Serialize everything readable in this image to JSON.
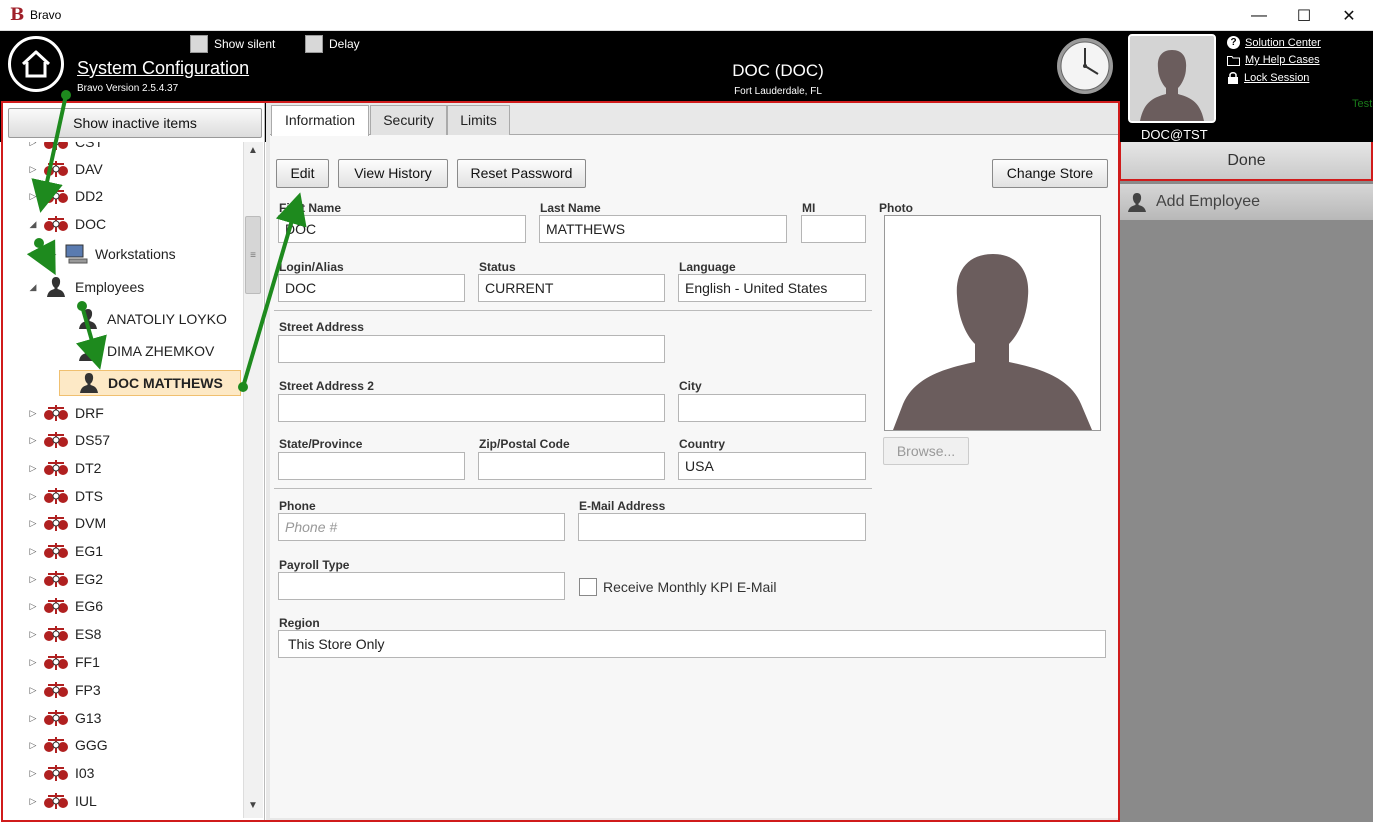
{
  "window": {
    "title": "Bravo",
    "logo": "B",
    "controls": {
      "minimize": "—",
      "maximize": "☐",
      "close": "✕"
    }
  },
  "header": {
    "title": "System Configuration",
    "version": "Bravo Version 2.5.4.37",
    "show_silent": "Show silent",
    "delay": "Delay",
    "store_title": "DOC (DOC)",
    "store_location": "Fort Lauderdale, FL",
    "user": "DOC@TST",
    "links": {
      "solution_center": "Solution Center",
      "help_cases": "My Help Cases",
      "lock_session": "Lock Session"
    },
    "env_label": "Test"
  },
  "sidebar": {
    "show_inactive": "Show inactive items",
    "tree": [
      {
        "label": "CST",
        "arrow": "▷",
        "kind": "store"
      },
      {
        "label": "DAV",
        "arrow": "▷",
        "kind": "store"
      },
      {
        "label": "DD2",
        "arrow": "▷",
        "kind": "store"
      },
      {
        "label": "DOC",
        "arrow": "◢",
        "kind": "store"
      },
      {
        "label": "Workstations",
        "arrow": "▷",
        "kind": "computer"
      },
      {
        "label": "Employees",
        "arrow": "◢",
        "kind": "person"
      },
      {
        "label": "ANATOLIY LOYKO",
        "arrow": "",
        "kind": "person"
      },
      {
        "label": "DIMA ZHEMKOV",
        "arrow": "",
        "kind": "person"
      },
      {
        "label": "DOC MATTHEWS",
        "arrow": "",
        "kind": "person"
      },
      {
        "label": "DRF",
        "arrow": "▷",
        "kind": "store"
      },
      {
        "label": "DS57",
        "arrow": "▷",
        "kind": "store"
      },
      {
        "label": "DT2",
        "arrow": "▷",
        "kind": "store"
      },
      {
        "label": "DTS",
        "arrow": "▷",
        "kind": "store"
      },
      {
        "label": "DVM",
        "arrow": "▷",
        "kind": "store"
      },
      {
        "label": "EG1",
        "arrow": "▷",
        "kind": "store"
      },
      {
        "label": "EG2",
        "arrow": "▷",
        "kind": "store"
      },
      {
        "label": "EG6",
        "arrow": "▷",
        "kind": "store"
      },
      {
        "label": "ES8",
        "arrow": "▷",
        "kind": "store"
      },
      {
        "label": "FF1",
        "arrow": "▷",
        "kind": "store"
      },
      {
        "label": "FP3",
        "arrow": "▷",
        "kind": "store"
      },
      {
        "label": "G13",
        "arrow": "▷",
        "kind": "store"
      },
      {
        "label": "GGG",
        "arrow": "▷",
        "kind": "store"
      },
      {
        "label": "I03",
        "arrow": "▷",
        "kind": "store"
      },
      {
        "label": "IUL",
        "arrow": "▷",
        "kind": "store"
      }
    ]
  },
  "tabs": [
    "Information",
    "Security",
    "Limits"
  ],
  "toolbar": {
    "edit": "Edit",
    "view_history": "View History",
    "reset_password": "Reset Password",
    "change_store": "Change Store"
  },
  "form": {
    "first_name": {
      "label": "First Name",
      "value": "DOC"
    },
    "last_name": {
      "label": "Last Name",
      "value": "MATTHEWS"
    },
    "mi": {
      "label": "MI",
      "value": ""
    },
    "photo": {
      "label": "Photo",
      "browse": "Browse..."
    },
    "login": {
      "label": "Login/Alias",
      "value": "DOC"
    },
    "status": {
      "label": "Status",
      "value": "CURRENT"
    },
    "language": {
      "label": "Language",
      "value": "English - United States"
    },
    "street1": {
      "label": "Street Address",
      "value": ""
    },
    "street2": {
      "label": "Street Address 2",
      "value": ""
    },
    "city": {
      "label": "City",
      "value": ""
    },
    "state": {
      "label": "State/Province",
      "value": ""
    },
    "zip": {
      "label": "Zip/Postal Code",
      "value": ""
    },
    "country": {
      "label": "Country",
      "value": "USA"
    },
    "phone": {
      "label": "Phone",
      "placeholder": "Phone #"
    },
    "email": {
      "label": "E-Mail Address",
      "value": ""
    },
    "payroll": {
      "label": "Payroll Type",
      "value": ""
    },
    "kpi": {
      "label": "Receive Monthly KPI E-Mail"
    },
    "region": {
      "label": "Region",
      "value": "This Store Only"
    }
  },
  "right_panel": {
    "done": "Done",
    "add_employee": "Add Employee"
  },
  "colors": {
    "header_bg": "#000000",
    "accent_red": "#d01b1b",
    "annotation_green": "#1e8a1e",
    "selected_row": "#fde9c6"
  }
}
